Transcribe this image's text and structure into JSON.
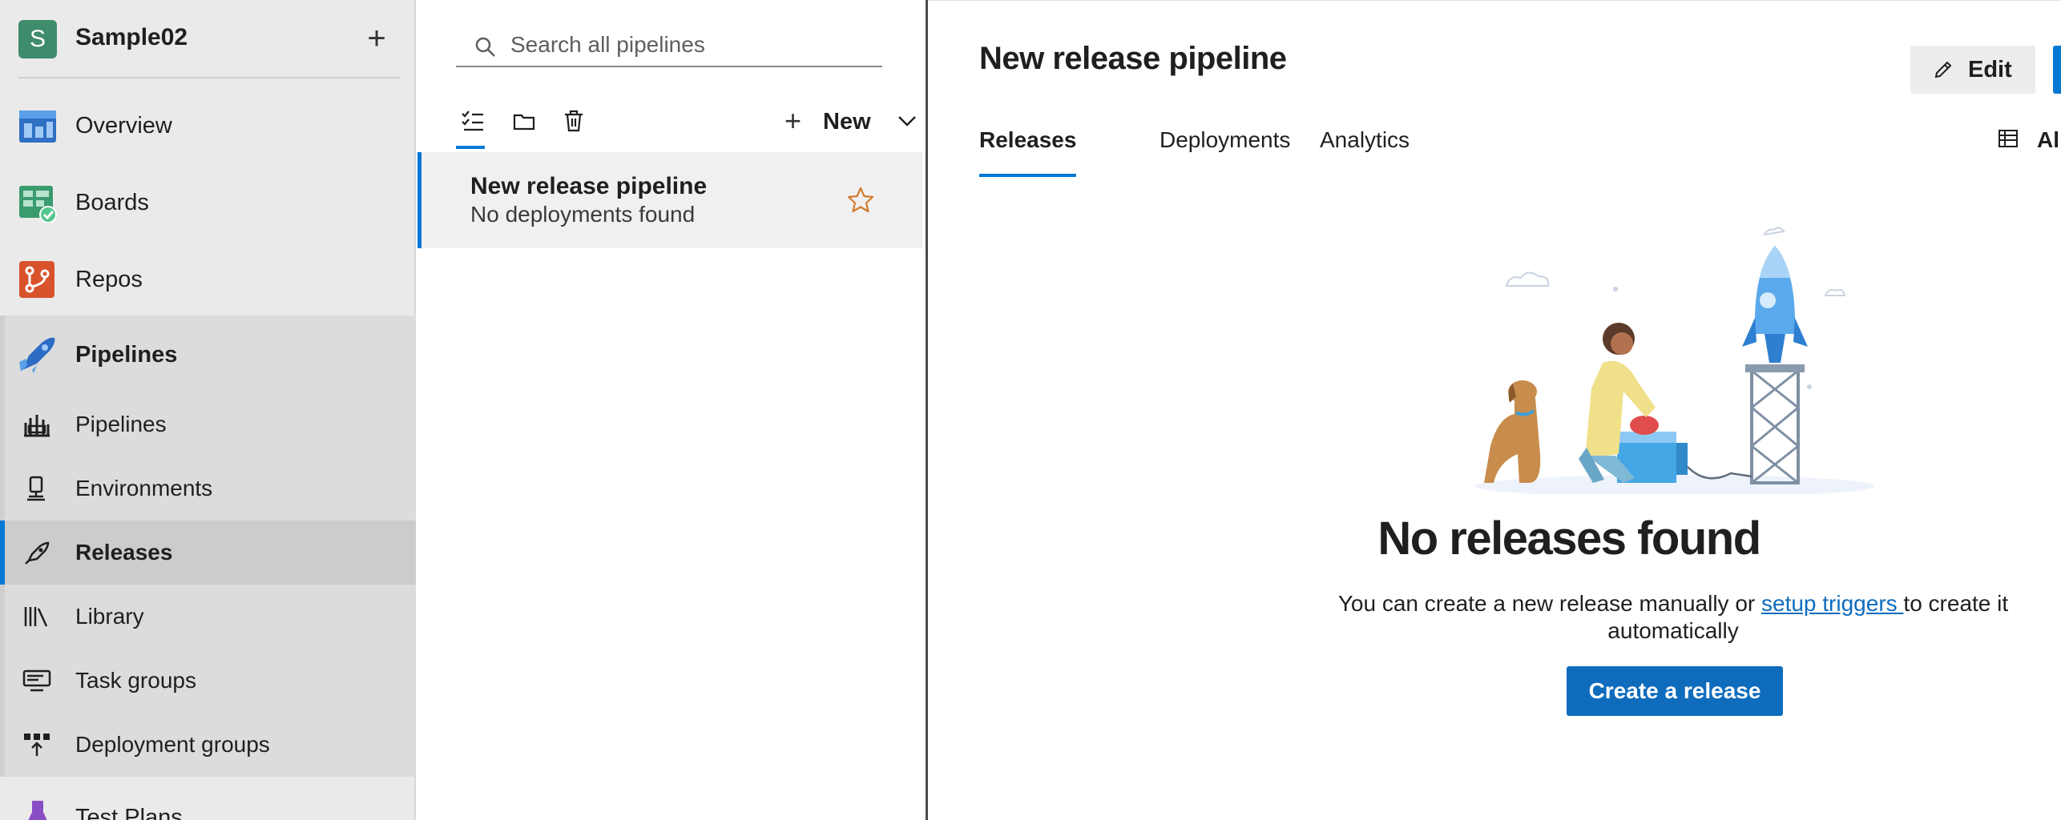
{
  "project": {
    "initial": "S",
    "name": "Sample02",
    "add_label": "+"
  },
  "nav": {
    "overview": "Overview",
    "boards": "Boards",
    "repos": "Repos",
    "pipelines_group": "Pipelines",
    "sub_items": [
      {
        "label": "Pipelines",
        "icon": "pipelines-icon"
      },
      {
        "label": "Environments",
        "icon": "environments-icon"
      },
      {
        "label": "Releases",
        "icon": "releases-icon",
        "selected": true
      },
      {
        "label": "Library",
        "icon": "library-icon"
      },
      {
        "label": "Task groups",
        "icon": "task-groups-icon"
      },
      {
        "label": "Deployment groups",
        "icon": "deployment-groups-icon"
      }
    ],
    "test_plans": "Test Plans"
  },
  "list": {
    "search_placeholder": "Search all pipelines",
    "new_label": "New",
    "pipelines": [
      {
        "name": "New release pipeline",
        "status": "No deployments found",
        "favorite": false
      }
    ]
  },
  "detail": {
    "title": "New release pipeline",
    "edit_label": "Edit",
    "tabs": [
      "Releases",
      "Deployments",
      "Analytics"
    ],
    "active_tab": "Releases",
    "view_label": "Al",
    "empty": {
      "title": "No releases found",
      "desc_before": "You can create a new release manually or ",
      "link": "setup triggers ",
      "desc_after": "to create it automatically",
      "button": "Create a release"
    }
  },
  "colors": {
    "accent": "#0078d4",
    "link": "#0f6cbd",
    "nav_bg": "#eaeaea",
    "selected_bg": "#cccccc",
    "star": "#d47a2c"
  }
}
